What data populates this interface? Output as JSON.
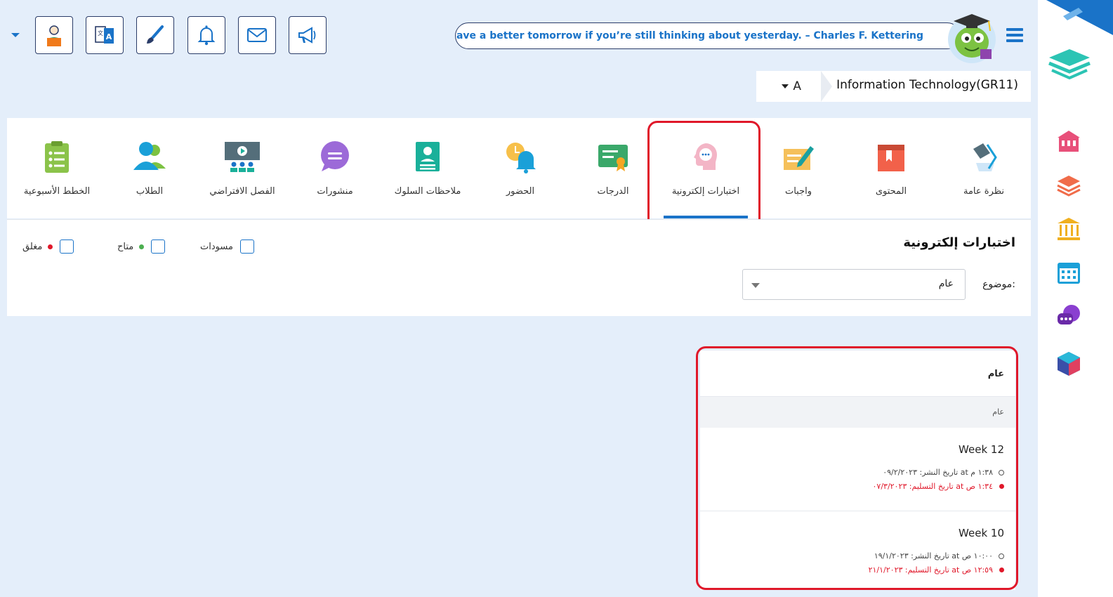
{
  "header": {
    "quote": "You can’t have a better tomorrow if you’re still thinking about yesterday. – Charles F. Kettering",
    "buttons": [
      "student-profile-icon",
      "translate-icon",
      "paint-brush-icon",
      "bell-icon",
      "mail-icon",
      "megaphone-icon"
    ]
  },
  "course": {
    "section": "A",
    "name": "Information Technology(GR11)"
  },
  "tabs": [
    {
      "label": "نظرة عامة",
      "icon": "overview-icon"
    },
    {
      "label": "المحتوى",
      "icon": "content-book-icon"
    },
    {
      "label": "واجبات",
      "icon": "homework-icon"
    },
    {
      "label": "اختبارات إلكترونية",
      "icon": "quiz-head-icon",
      "active": true
    },
    {
      "label": "الدرجات",
      "icon": "certificate-icon"
    },
    {
      "label": "الحضور",
      "icon": "attendance-bell-icon"
    },
    {
      "label": "ملاحظات السلوك",
      "icon": "behavior-notes-icon"
    },
    {
      "label": "منشورات",
      "icon": "posts-chat-icon"
    },
    {
      "label": "الفصل الافتراضي",
      "icon": "virtual-class-icon"
    },
    {
      "label": "الطلاب",
      "icon": "students-icon"
    },
    {
      "label": "الخطط الأسبوعية",
      "icon": "weekly-plan-icon"
    }
  ],
  "filter": {
    "title": "اختبارات إلكترونية",
    "legend": {
      "draft": "مسودات",
      "available": "متاح",
      "closed": "مغلق"
    },
    "subject_label": "موضوع:",
    "subject_value": "عام"
  },
  "colors": {
    "accent": "#1a73c8",
    "available": "#4caf50",
    "closed": "#e0182a",
    "background": "#e4eefa"
  },
  "list": {
    "header": "عام",
    "subheader": "عام",
    "items": [
      {
        "title": "Week 12",
        "published": "تاريخ النشر: ٠٩/٢/٢٠٢٣ at ١:٣٨ م",
        "due": "تاريخ التسليم: ٠٧/٣/٢٠٢٣ at ١:٣٤ ص"
      },
      {
        "title": "Week 10",
        "published": "تاريخ النشر: ١٩/١/٢٠٢٣ at ١٠:٠٠ ص",
        "due": "تاريخ التسليم: ٢١/١/٢٠٢٣ at ١٢:٥٩ ص"
      }
    ]
  },
  "sidebar": {
    "items": [
      "layers-logo-icon",
      "school-icon",
      "books-icon",
      "institution-icon",
      "calendar-icon",
      "chat-bubbles-icon",
      "cube-icon"
    ]
  }
}
